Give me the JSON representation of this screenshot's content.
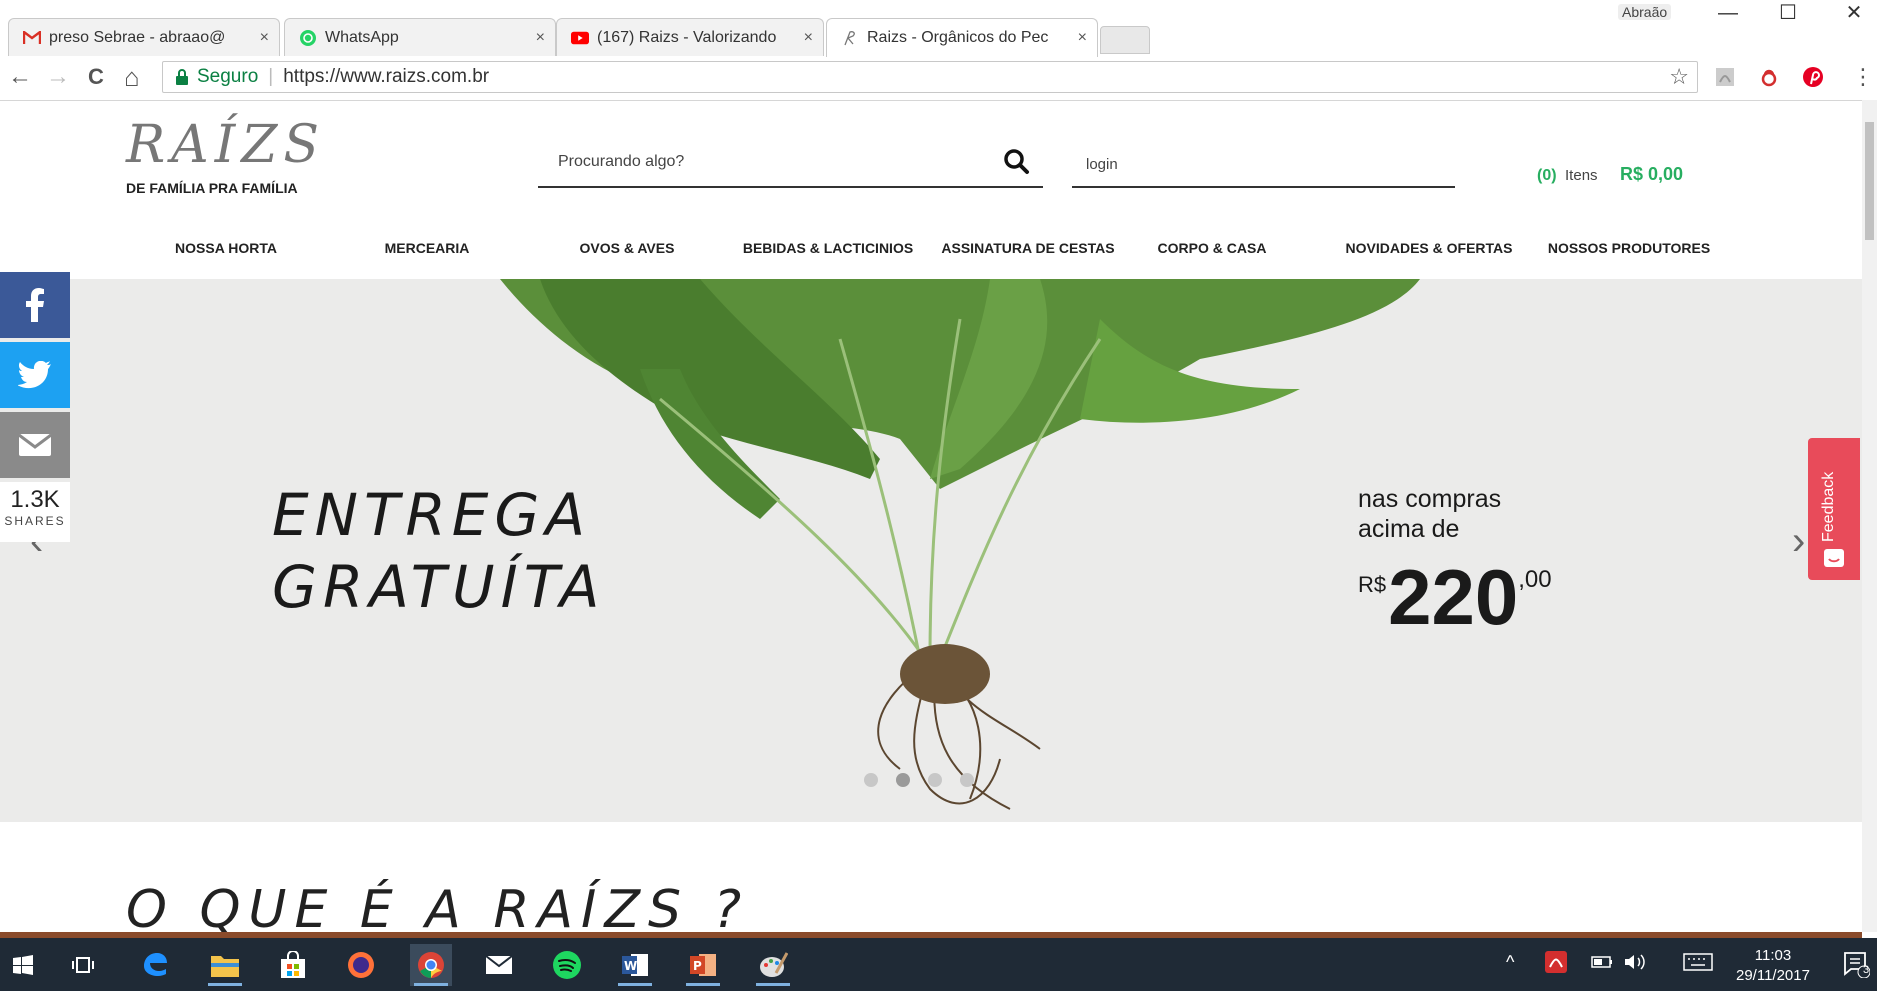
{
  "browser": {
    "tabs": [
      {
        "title": "preso Sebrae - abraao@",
        "icon": "gmail-icon",
        "close": "×"
      },
      {
        "title": "WhatsApp",
        "icon": "whatsapp-icon",
        "close": "×"
      },
      {
        "title": "(167) Raizs - Valorizando",
        "icon": "youtube-icon",
        "close": "×"
      },
      {
        "title": "Raizs - Orgânicos do Pec",
        "icon": "raizs-icon",
        "close": "×"
      }
    ],
    "profile": "Abraão",
    "window_controls": {
      "minimize": "—",
      "maximize": "☐",
      "close": "✕"
    },
    "nav": {
      "back": "←",
      "forward": "→",
      "reload": "C",
      "home": "⌂"
    },
    "security_label": "Seguro",
    "url": "https://www.raizs.com.br"
  },
  "site": {
    "logo_text": "RAÍZS",
    "tagline": "DE FAMÍLIA PRA FAMÍLIA",
    "search_placeholder": "Procurando algo?",
    "login_placeholder": "login",
    "cart": {
      "count": "(0)",
      "itens": "Itens",
      "total": "R$ 0,00"
    },
    "menu": [
      "NOSSA HORTA",
      "MERCEARIA",
      "OVOS & AVES",
      "BEBIDAS & LACTICINIOS",
      "ASSINATURA DE CESTAS",
      "CORPO & CASA",
      "NOVIDADES & OFERTAS",
      "NOSSOS PRODUTORES"
    ],
    "hero": {
      "line1": "ENTREGA",
      "line2": "GRATUÍTA",
      "right_line1": "nas compras",
      "right_line2": "acima de",
      "currency": "R$",
      "amount": "220",
      "cents": ",00",
      "slides_total": 4,
      "active_slide": 2
    },
    "share": {
      "count": "1.3K",
      "label": "SHARES"
    },
    "feedback_label": "Feedback",
    "section_title": "O QUE É A RAÍZS ?"
  },
  "taskbar": {
    "time": "11:03",
    "date": "29/11/2017",
    "notification_count": "3"
  },
  "colors": {
    "accent_green": "#27ae60",
    "facebook": "#3b5998",
    "twitter": "#1da1f2",
    "feedback": "#e84b5a",
    "taskbar": "#1f2a36"
  }
}
